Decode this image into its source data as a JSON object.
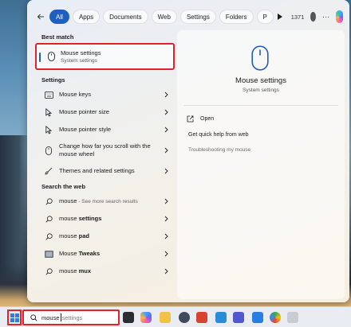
{
  "filters": {
    "chips": [
      "All",
      "Apps",
      "Documents",
      "Web",
      "Settings",
      "Folders",
      "P"
    ],
    "count": "1371",
    "accent": "#1f5fbf"
  },
  "best_match": {
    "heading": "Best match",
    "title": "Mouse settings",
    "subtitle": "System settings"
  },
  "settings": {
    "heading": "Settings",
    "items": [
      "Mouse keys",
      "Mouse pointer size",
      "Mouse pointer style",
      "Change how far you scroll with the mouse wheel",
      "Themes and related settings"
    ]
  },
  "web": {
    "heading": "Search the web",
    "items": [
      {
        "bold": "",
        "text": "mouse",
        "sub": " - See more search results"
      },
      {
        "bold": "settings",
        "text": "mouse ",
        "sub": ""
      },
      {
        "bold": "pad",
        "text": "mouse ",
        "sub": ""
      },
      {
        "bold": "Tweaks",
        "text": "Mouse ",
        "sub": ""
      },
      {
        "bold": "mux",
        "text": "mouse ",
        "sub": ""
      }
    ]
  },
  "detail": {
    "title": "Mouse settings",
    "subtitle": "System settings",
    "open_label": "Open",
    "help_label": "Get quick help from web",
    "trouble_label": "Troubleshooting my mouse"
  },
  "taskbar": {
    "search_value": "mouse",
    "search_placeholder": "settings"
  },
  "colors": {
    "highlight_border": "#e2232a",
    "win_blue": "#2b7de0"
  }
}
